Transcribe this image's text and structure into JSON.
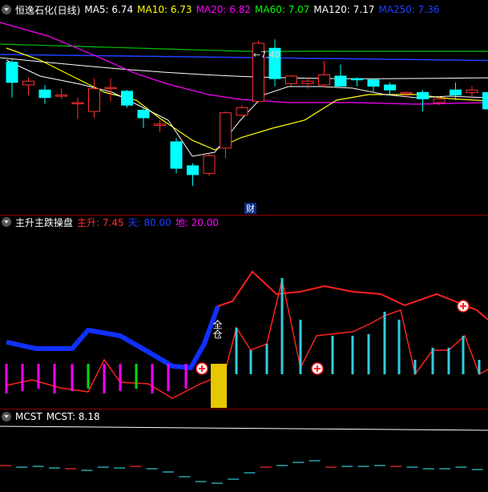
{
  "main_panel": {
    "stock_name": "恒逸石化(日线)",
    "indicators": [
      {
        "label": "MA5: 6.74",
        "color": "#ffffff"
      },
      {
        "label": "MA10: 6.73",
        "color": "#ffff00"
      },
      {
        "label": "MA20: 6.82",
        "color": "#ff00ff"
      },
      {
        "label": "MA60: 7.07",
        "color": "#00ff00"
      },
      {
        "label": "MA120: 7.17",
        "color": "#ffffff"
      },
      {
        "label": "MA250: 7.36",
        "color": "#2040ff"
      }
    ],
    "peak_label": "←7.40",
    "finance_marker": "财"
  },
  "sub_panel": {
    "title": "主升主跌操盘",
    "indicators": [
      {
        "label": "主升: 7.45",
        "color": "#ff3030"
      },
      {
        "label": "天: 80.00",
        "color": "#2040ff"
      },
      {
        "label": "地: 20.00",
        "color": "#ff00ff"
      }
    ],
    "annotation": "全仓"
  },
  "mcst_panel": {
    "title": "MCST",
    "indicators": [
      {
        "label": "MCST: 8.18",
        "color": "#ffffff"
      }
    ]
  },
  "colors": {
    "up": "#ff3030",
    "down": "#00ffff",
    "separator": "#8b0000",
    "gold": "#e6c800"
  },
  "candles": [
    {
      "o": 7.18,
      "h": 7.2,
      "l": 6.9,
      "c": 7.02
    },
    {
      "o": 7.0,
      "h": 7.06,
      "l": 6.92,
      "c": 7.03
    },
    {
      "o": 6.96,
      "h": 7.0,
      "l": 6.85,
      "c": 6.9
    },
    {
      "o": 6.91,
      "h": 6.97,
      "l": 6.89,
      "c": 6.92
    },
    {
      "o": 6.86,
      "h": 6.9,
      "l": 6.73,
      "c": 6.86
    },
    {
      "o": 6.79,
      "h": 7.05,
      "l": 6.74,
      "c": 6.97
    },
    {
      "o": 6.98,
      "h": 7.05,
      "l": 6.87,
      "c": 6.98
    },
    {
      "o": 6.95,
      "h": 6.96,
      "l": 6.82,
      "c": 6.84
    },
    {
      "o": 6.8,
      "h": 6.82,
      "l": 6.66,
      "c": 6.74
    },
    {
      "o": 6.68,
      "h": 6.72,
      "l": 6.63,
      "c": 6.69
    },
    {
      "o": 6.55,
      "h": 6.58,
      "l": 6.3,
      "c": 6.34
    },
    {
      "o": 6.36,
      "h": 6.38,
      "l": 6.2,
      "c": 6.29
    },
    {
      "o": 6.3,
      "h": 6.46,
      "l": 6.28,
      "c": 6.44
    },
    {
      "o": 6.5,
      "h": 6.79,
      "l": 6.42,
      "c": 6.78
    },
    {
      "o": 6.76,
      "h": 6.84,
      "l": 6.75,
      "c": 6.82
    },
    {
      "o": 6.87,
      "h": 7.35,
      "l": 6.86,
      "c": 7.33
    },
    {
      "o": 7.29,
      "h": 7.36,
      "l": 6.99,
      "c": 7.05
    },
    {
      "o": 7.01,
      "h": 7.08,
      "l": 6.99,
      "c": 7.07
    },
    {
      "o": 7.01,
      "h": 7.06,
      "l": 6.97,
      "c": 7.03
    },
    {
      "o": 7.0,
      "h": 7.19,
      "l": 6.98,
      "c": 7.08
    },
    {
      "o": 7.07,
      "h": 7.16,
      "l": 6.99,
      "c": 6.99
    },
    {
      "o": 7.05,
      "h": 7.06,
      "l": 6.99,
      "c": 7.04
    },
    {
      "o": 7.04,
      "h": 7.05,
      "l": 6.94,
      "c": 6.99
    },
    {
      "o": 7.0,
      "h": 7.02,
      "l": 6.92,
      "c": 6.96
    },
    {
      "o": 6.94,
      "h": 6.95,
      "l": 6.9,
      "c": 6.94
    },
    {
      "o": 6.94,
      "h": 6.96,
      "l": 6.79,
      "c": 6.89
    },
    {
      "o": 6.86,
      "h": 6.91,
      "l": 6.84,
      "c": 6.89
    },
    {
      "o": 6.96,
      "h": 7.02,
      "l": 6.88,
      "c": 6.92
    },
    {
      "o": 6.94,
      "h": 6.99,
      "l": 6.91,
      "c": 6.96
    },
    {
      "o": 6.94,
      "h": 6.96,
      "l": 6.8,
      "c": 6.81
    }
  ]
}
